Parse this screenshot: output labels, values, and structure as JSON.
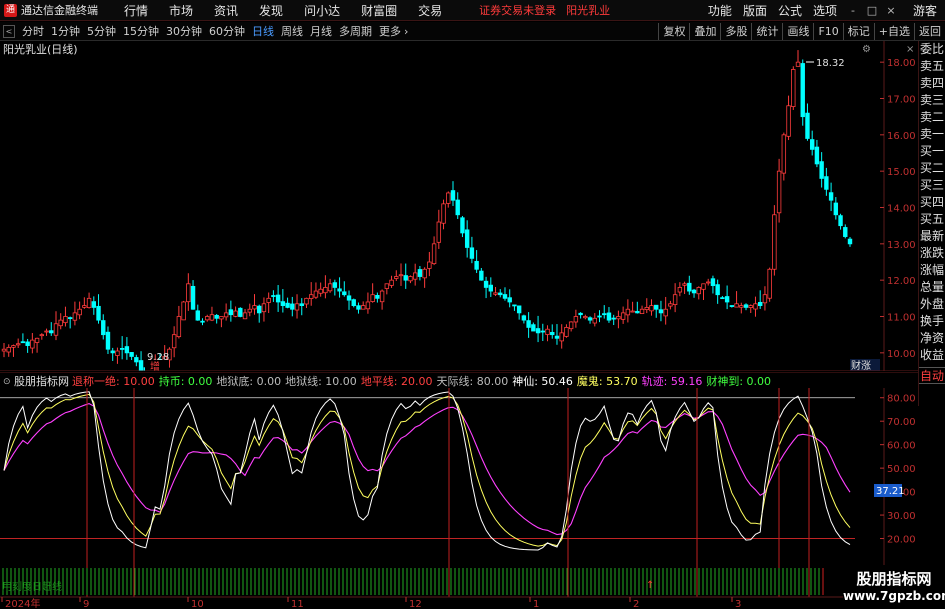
{
  "titlebar": {
    "app_title": "通达信金融终端",
    "menus": [
      "行情",
      "市场",
      "资讯",
      "发现",
      "问小达",
      "财富圈",
      "交易"
    ],
    "notice": "证券交易未登录",
    "stock_name": "阳光乳业",
    "right_menus": [
      "功能",
      "版面",
      "公式",
      "选项"
    ],
    "guest": "游客",
    "controls": [
      "-",
      "□",
      "×"
    ]
  },
  "periodbar": {
    "periods": [
      "分时",
      "1分钟",
      "5分钟",
      "15分钟",
      "30分钟",
      "60分钟",
      "日线",
      "周线",
      "月线",
      "多周期",
      "更多"
    ],
    "active": "日线",
    "tools": [
      "复权",
      "叠加",
      "多股",
      "统计",
      "画线",
      "F10",
      "标记",
      "+自选",
      "返回"
    ]
  },
  "price_panel": {
    "title": "阳光乳业(日线)",
    "high_label": "18.32",
    "low_label": "9.28",
    "zeng_label": "增",
    "caizhang": "财涨",
    "axis_ticks": [
      18,
      17,
      16,
      15,
      14,
      13,
      12,
      11,
      10
    ],
    "tick_labels": [
      "18.00",
      "17.00",
      "16.00",
      "15.00",
      "14.00",
      "13.00",
      "12.00",
      "11.00",
      "10.00"
    ]
  },
  "indicator_panel": {
    "name": "股朋指标网",
    "params": [
      {
        "label": "退称一绝:",
        "value": "10.00",
        "color": "#ff4040"
      },
      {
        "label": "持币:",
        "value": "0.00",
        "color": "#40ff40"
      },
      {
        "label": "地狱底:",
        "value": "0.00",
        "color": "#bbbbbb"
      },
      {
        "label": "地狱线:",
        "value": "10.00",
        "color": "#bbbbbb"
      },
      {
        "label": "地平线:",
        "value": "20.00",
        "color": "#ff4040"
      },
      {
        "label": "天际线:",
        "value": "80.00",
        "color": "#bbbbbb"
      },
      {
        "label": "神仙:",
        "value": "50.46",
        "color": "#ffffff"
      },
      {
        "label": "魔鬼:",
        "value": "53.70",
        "color": "#ffff60"
      },
      {
        "label": "轨迹:",
        "value": "59.16",
        "color": "#ff40ff"
      },
      {
        "label": "财神到:",
        "value": "0.00",
        "color": "#40ff40"
      }
    ],
    "axis_ticks": [
      80,
      70,
      60,
      50,
      40,
      30,
      20
    ],
    "tick_labels": [
      "80.00",
      "70.00",
      "60.00",
      "50.00",
      "40.00",
      "30.00",
      "20.00"
    ],
    "cursor_value": "37.21",
    "bottom_caption": "用刻度日赶线"
  },
  "date_axis": {
    "labels": [
      "2024年",
      "9",
      "10",
      "11",
      "12",
      "1",
      "2",
      "3"
    ]
  },
  "right_panel": {
    "items": [
      "委比",
      "卖五",
      "卖四",
      "卖三",
      "卖二",
      "卖一",
      "买一",
      "买二",
      "买三",
      "买四",
      "买五",
      "最新",
      "涨跌",
      "涨幅",
      "总量",
      "外盘",
      "换手",
      "净资",
      "收益"
    ],
    "auto": "自动"
  },
  "watermark": {
    "line1": "股朋指标网",
    "line2": "www.7gpzb.com"
  },
  "colors": {
    "up": "#ff3c3c",
    "down": "#00ffff",
    "kline_white": "#ffffff",
    "yellow": "#ffff60",
    "magenta": "#ff40ff",
    "grid": "#3a0f0f"
  },
  "chart_data": {
    "type": "candlestick",
    "y_axis_price": [
      9.5,
      18.5
    ],
    "y_axis_indicator": [
      10,
      85
    ],
    "closes": [
      10.1,
      10.15,
      10.2,
      10.25,
      10.3,
      10.2,
      10.35,
      10.4,
      10.5,
      10.6,
      10.55,
      10.8,
      10.9,
      11.0,
      10.95,
      11.1,
      11.2,
      11.3,
      11.5,
      11.25,
      10.9,
      10.5,
      10.1,
      10.0,
      10.05,
      10.1,
      10.0,
      9.9,
      9.75,
      9.5,
      9.45,
      9.7,
      9.8,
      9.6,
      9.9,
      10.1,
      10.5,
      11.0,
      11.4,
      11.9,
      11.2,
      10.9,
      10.85,
      11.0,
      11.05,
      10.95,
      11.0,
      11.1,
      11.05,
      11.15,
      11.0,
      11.1,
      11.2,
      11.3,
      11.1,
      11.35,
      11.5,
      11.55,
      11.4,
      11.3,
      11.25,
      11.2,
      11.35,
      11.3,
      11.5,
      11.6,
      11.7,
      11.75,
      11.8,
      11.9,
      11.8,
      11.7,
      11.6,
      11.45,
      11.3,
      11.2,
      11.3,
      11.4,
      11.6,
      11.5,
      11.7,
      11.9,
      12.0,
      12.1,
      12.15,
      12.0,
      12.1,
      12.2,
      12.1,
      12.3,
      12.5,
      13.0,
      13.6,
      14.1,
      14.4,
      14.2,
      13.8,
      13.3,
      12.9,
      12.6,
      12.3,
      12.0,
      11.8,
      11.7,
      11.65,
      11.6,
      11.5,
      11.4,
      11.3,
      11.1,
      10.9,
      10.7,
      10.6,
      10.55,
      10.6,
      10.65,
      10.5,
      10.4,
      10.55,
      10.7,
      10.85,
      11.0,
      11.05,
      11.0,
      10.9,
      10.95,
      11.0,
      11.05,
      10.9,
      10.95,
      11.0,
      11.1,
      11.2,
      11.15,
      11.1,
      11.2,
      11.25,
      11.3,
      11.2,
      11.1,
      11.2,
      11.35,
      11.6,
      11.8,
      11.9,
      11.7,
      11.65,
      11.8,
      11.9,
      11.95,
      11.85,
      11.6,
      11.5,
      11.4,
      11.3,
      11.35,
      11.3,
      11.25,
      11.3,
      11.35,
      11.3,
      11.6,
      12.3,
      13.8,
      15.0,
      16.0,
      16.8,
      17.8,
      18.0,
      16.5,
      15.9,
      15.6,
      15.2,
      14.8,
      14.5,
      14.2,
      13.8,
      13.5,
      13.2,
      13.0
    ]
  }
}
